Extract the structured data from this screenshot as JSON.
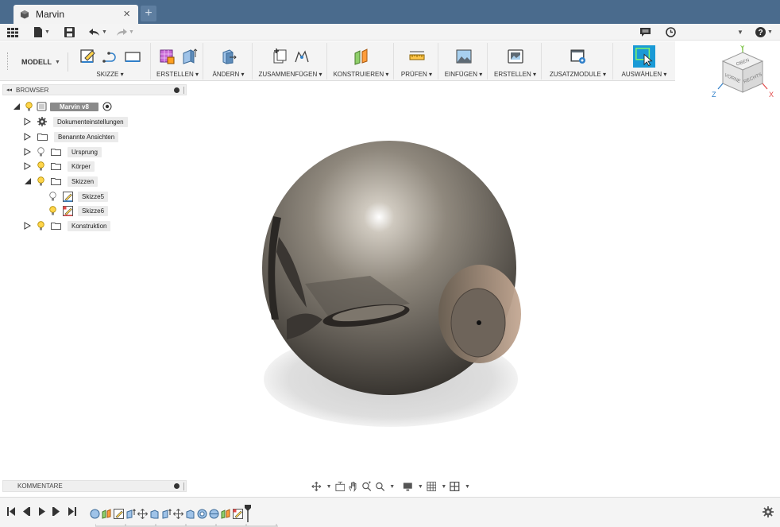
{
  "window": {
    "tab_title": "Marvin",
    "close_glyph": "×",
    "new_tab_glyph": "+"
  },
  "ribbon": {
    "workspace_label": "MODELL",
    "groups": [
      {
        "label": "SKIZZE ▾"
      },
      {
        "label": "ERSTELLEN ▾"
      },
      {
        "label": "ÄNDERN ▾"
      },
      {
        "label": "ZUSAMMENFÜGEN ▾"
      },
      {
        "label": "KONSTRUIEREN ▾"
      },
      {
        "label": "PRÜFEN ▾"
      },
      {
        "label": "EINFÜGEN ▾"
      },
      {
        "label": "ERSTELLEN ▾"
      },
      {
        "label": "ZUSATZMODULE ▾"
      },
      {
        "label": "AUSWÄHLEN ▾"
      }
    ]
  },
  "browser": {
    "title": "BROWSER",
    "collapse_glyph": "◂◂",
    "root": "Marvin v8",
    "items": [
      {
        "label": "Dokumenteinstellungen"
      },
      {
        "label": "Benannte Ansichten"
      },
      {
        "label": "Ursprung"
      },
      {
        "label": "Körper"
      },
      {
        "label": "Skizzen"
      },
      {
        "label": "Skizze5"
      },
      {
        "label": "Skizze6"
      },
      {
        "label": "Konstruktion"
      }
    ]
  },
  "comments": {
    "title": "KOMMENTARE"
  },
  "viewcube": {
    "top": "OBEN",
    "front": "VORNE",
    "right": "RECHTS",
    "axis_x": "X",
    "axis_y": "Y",
    "axis_z": "Z"
  },
  "colors": {
    "titlebar": "#4a6b8d",
    "panel": "#f4f4f4",
    "select_accent": "#1a9ad6",
    "sphere_dark": "#3d3a35",
    "sphere_light": "#a49d92"
  }
}
